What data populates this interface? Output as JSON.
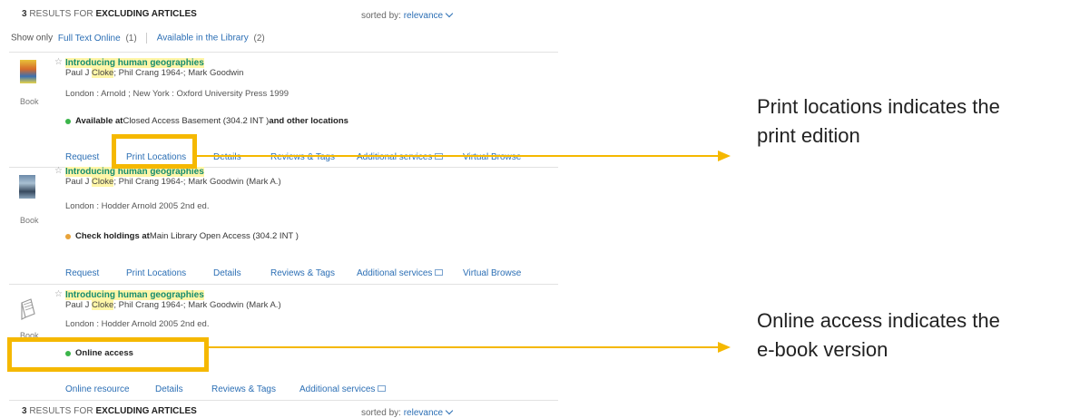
{
  "header_top": {
    "count": "3",
    "label": "RESULTS FOR",
    "query": "EXCLUDING ARTICLES",
    "sorted_label": "sorted by:",
    "sorted_value": "relevance"
  },
  "facets": {
    "show_only": "Show only",
    "full_text": "Full Text Online",
    "full_text_count": "(1)",
    "library": "Available in the Library",
    "library_count": "(2)"
  },
  "results": [
    {
      "type_label": "Book",
      "title": "Introducing human geographies",
      "author_pre": "Paul J ",
      "author_hl": "Cloke",
      "author_post": "; Phil Crang 1964-; Mark Goodwin",
      "publisher": "London : Arnold ; New York : Oxford University Press 1999",
      "status_prefix": "Available at",
      "status_location": " Closed Access Basement (304.2 INT ) ",
      "status_suffix": "and other locations",
      "tabs": [
        "Request",
        "Print Locations",
        "Details",
        "Reviews & Tags",
        "Additional services",
        "Virtual Browse"
      ],
      "status_color": "#3bb54a"
    },
    {
      "type_label": "Book",
      "title": "Introducing human geographies",
      "author_pre": "Paul J ",
      "author_hl": "Cloke",
      "author_post": "; Phil Crang 1964-; Mark Goodwin (Mark A.)",
      "publisher": "London : Hodder Arnold 2005 2nd ed.",
      "status_prefix": "Check holdings at",
      "status_location": " Main Library Open Access (304.2 INT )",
      "tabs": [
        "Request",
        "Print Locations",
        "Details",
        "Reviews & Tags",
        "Additional services",
        "Virtual Browse"
      ],
      "status_color": "#e8a33a"
    },
    {
      "type_label": "Book",
      "title": "Introducing human geographies",
      "author_pre": "Paul J ",
      "author_hl": "Cloke",
      "author_post": "; Phil Crang 1964-; Mark Goodwin (Mark A.)",
      "publisher": "London : Hodder Arnold 2005 2nd ed.",
      "status_prefix": "Online access",
      "tabs": [
        "Online resource",
        "Details",
        "Reviews & Tags",
        "Additional services"
      ],
      "status_color": "#3bb54a"
    }
  ],
  "header_bottom": {
    "count": "3",
    "label": "RESULTS FOR",
    "query": "EXCLUDING ARTICLES",
    "sorted_label": "sorted by:",
    "sorted_value": "relevance"
  },
  "annotations": {
    "print_line1": "Print locations indicates the",
    "print_line2": "print edition",
    "online_line1": "Online access indicates the",
    "online_line2": "e-book version"
  },
  "colors": {
    "highlight": "#f5b800",
    "link": "#2c6fb5",
    "title": "#158c6e"
  }
}
